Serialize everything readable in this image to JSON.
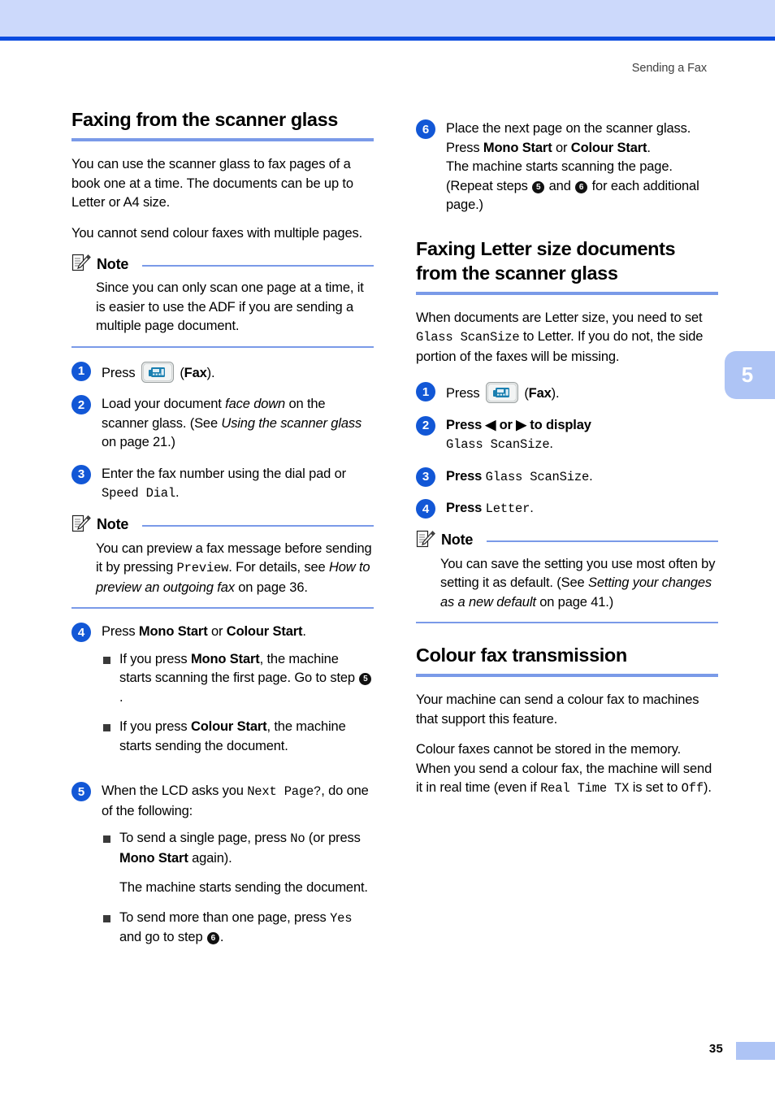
{
  "header": {
    "running_head": "Sending a Fax"
  },
  "chapter_tab": {
    "number": "5"
  },
  "footer": {
    "page_number": "35"
  },
  "left_column": {
    "section": {
      "title": "Faxing from the scanner glass",
      "paragraphs": [
        "You can use the scanner glass to fax pages of a book one at a time. The documents can be up to Letter or A4 size.",
        "You cannot send colour faxes with multiple pages."
      ]
    },
    "note1": {
      "label": "Note",
      "text": "Since you can only scan one page at a time, it is easier to use the ADF if you are sending a multiple page document."
    },
    "step1": {
      "number": "1",
      "press": "Press",
      "icon": "fax-key-icon",
      "paren_open": "(",
      "key": "Fax",
      "paren_close": ")."
    },
    "step2": {
      "number": "2",
      "t1": "Load your document ",
      "em1": "face down",
      "t2": " on the scanner glass. (See ",
      "em2": "Using the scanner glass",
      "t3": " on page 21.)"
    },
    "step3": {
      "number": "3",
      "t1": "Enter the fax number using the dial pad or ",
      "mono": "Speed Dial",
      "t2": "."
    },
    "note2": {
      "label": "Note",
      "t1": "You can preview a fax message before sending it by pressing ",
      "mono": "Preview",
      "t2": ". For details, see ",
      "em": "How to preview an outgoing fax",
      "t3": " on page 36."
    },
    "step4": {
      "number": "4",
      "t1": "Press ",
      "b1": "Mono Start",
      "t2": " or ",
      "b2": "Colour Start",
      "t3": ".",
      "bullets": [
        {
          "t1": "If you press ",
          "b1": "Mono Start",
          "t2": ", the machine starts scanning the first page. Go to step ",
          "ref": "5",
          "t3": "."
        },
        {
          "t1": "If you press ",
          "b1": "Colour Start",
          "t2": ", the machine starts sending the document.",
          "ref": "",
          "t3": ""
        }
      ]
    },
    "step5": {
      "number": "5",
      "t1": "When the LCD asks you ",
      "mono": "Next Page?",
      "t2": ", do one of the following:",
      "bullets": [
        {
          "t1": "To send a single page, press ",
          "mono": "No",
          "t2": " (or press ",
          "b1": "Mono Start",
          "t3": " again)."
        },
        {
          "plain": "The machine starts sending the document."
        },
        {
          "t1": "To send more than one page, press ",
          "mono": "Yes",
          "t2": " and go to step ",
          "ref": "6",
          "t3": "."
        }
      ]
    }
  },
  "right_column": {
    "step6": {
      "number": "6",
      "t1": "Place the next page on the scanner glass.",
      "t2": "Press ",
      "b1": "Mono Start",
      "t3": " or ",
      "b2": "Colour Start",
      "t4": ".",
      "t5": "The machine starts scanning the page.",
      "t6": "(Repeat steps ",
      "ref1": "5",
      "t7": " and ",
      "ref2": "6",
      "t8": " for each additional page.)"
    },
    "section_letter": {
      "title": "Faxing Letter size documents from the scanner glass",
      "intro_t1": "When documents are Letter size, you need to set ",
      "intro_mono1": "Glass ScanSize",
      "intro_t2": " to Letter. If you do not, the side portion of the faxes will be missing."
    },
    "step1": {
      "number": "1",
      "press": "Press",
      "icon": "fax-key-icon",
      "paren_open": "(",
      "key": "Fax",
      "paren_close": ")."
    },
    "step2": {
      "number": "2",
      "t1": "Press ",
      "arrow_left": "◀",
      "t2": " or ",
      "arrow_right": "▶",
      "t3": " to display",
      "mono": "Glass ScanSize",
      "t4": "."
    },
    "step3": {
      "number": "3",
      "t1": "Press ",
      "mono": "Glass ScanSize",
      "t2": "."
    },
    "step4": {
      "number": "4",
      "t1": "Press ",
      "mono": "Letter",
      "t2": "."
    },
    "note": {
      "label": "Note",
      "t1": "You can save the setting you use most often by setting it as default. (See ",
      "em": "Setting your changes as a new default",
      "t2": " on page 41.)"
    },
    "section_colour": {
      "title": "Colour fax transmission",
      "p1": "Your machine can send a colour fax to machines that support this feature.",
      "p2_t1": "Colour faxes cannot be stored in the memory. When you send a colour fax, the machine will send it in real time (even if ",
      "p2_mono1": "Real Time TX",
      "p2_t2": " is set to ",
      "p2_mono2": "Off",
      "p2_t3": ")."
    }
  },
  "colors": {
    "header_band": "#ccd9fb",
    "header_rule": "#0b4ce0",
    "heading_rule": "#7a9ae8",
    "step_circle": "#1257d6",
    "tab": "#aec4f5"
  }
}
